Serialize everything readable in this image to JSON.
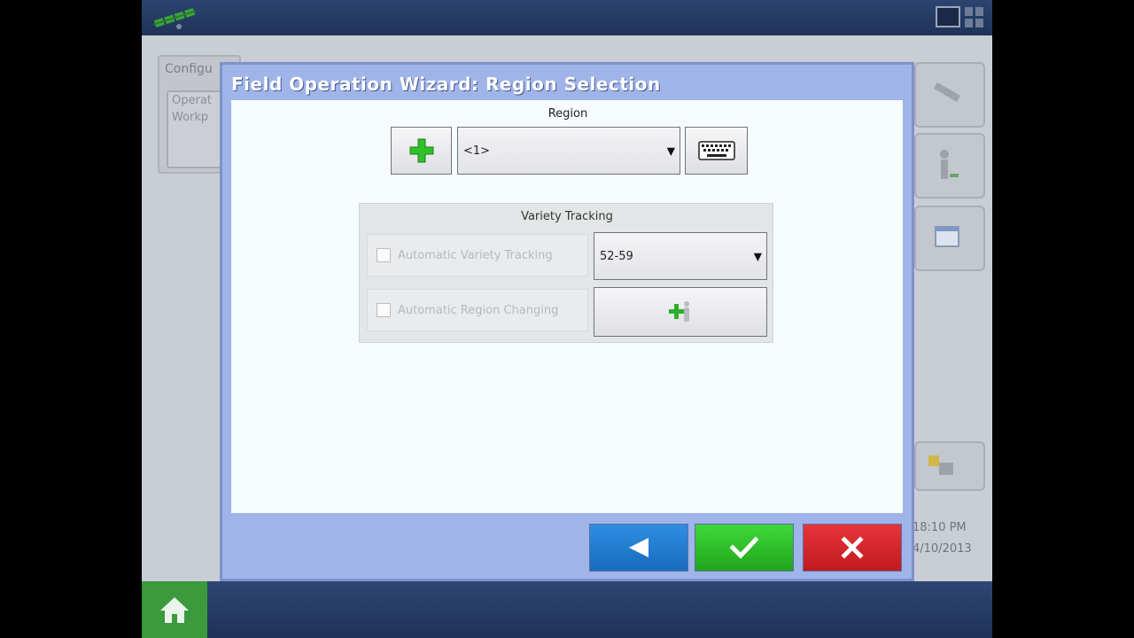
{
  "dialog": {
    "title": "Field Operation Wizard: Region Selection",
    "region_label": "Region",
    "region_value": "<1>",
    "variety_tracking": {
      "title": "Variety Tracking",
      "auto_variety_label": "Automatic Variety Tracking",
      "auto_variety_checked": false,
      "variety_value": "52-59",
      "auto_region_label": "Automatic Region Changing",
      "auto_region_checked": false
    }
  },
  "background": {
    "panel_title": "Configu",
    "panel_lines": [
      "Operat",
      "Workp"
    ],
    "time": "18:10 PM",
    "date": "4/10/2013"
  },
  "colors": {
    "dialog_frame": "#9fb4e8",
    "back_button": "#1f7fd6",
    "ok_button": "#2fbf2b",
    "cancel_button": "#d6262c"
  }
}
